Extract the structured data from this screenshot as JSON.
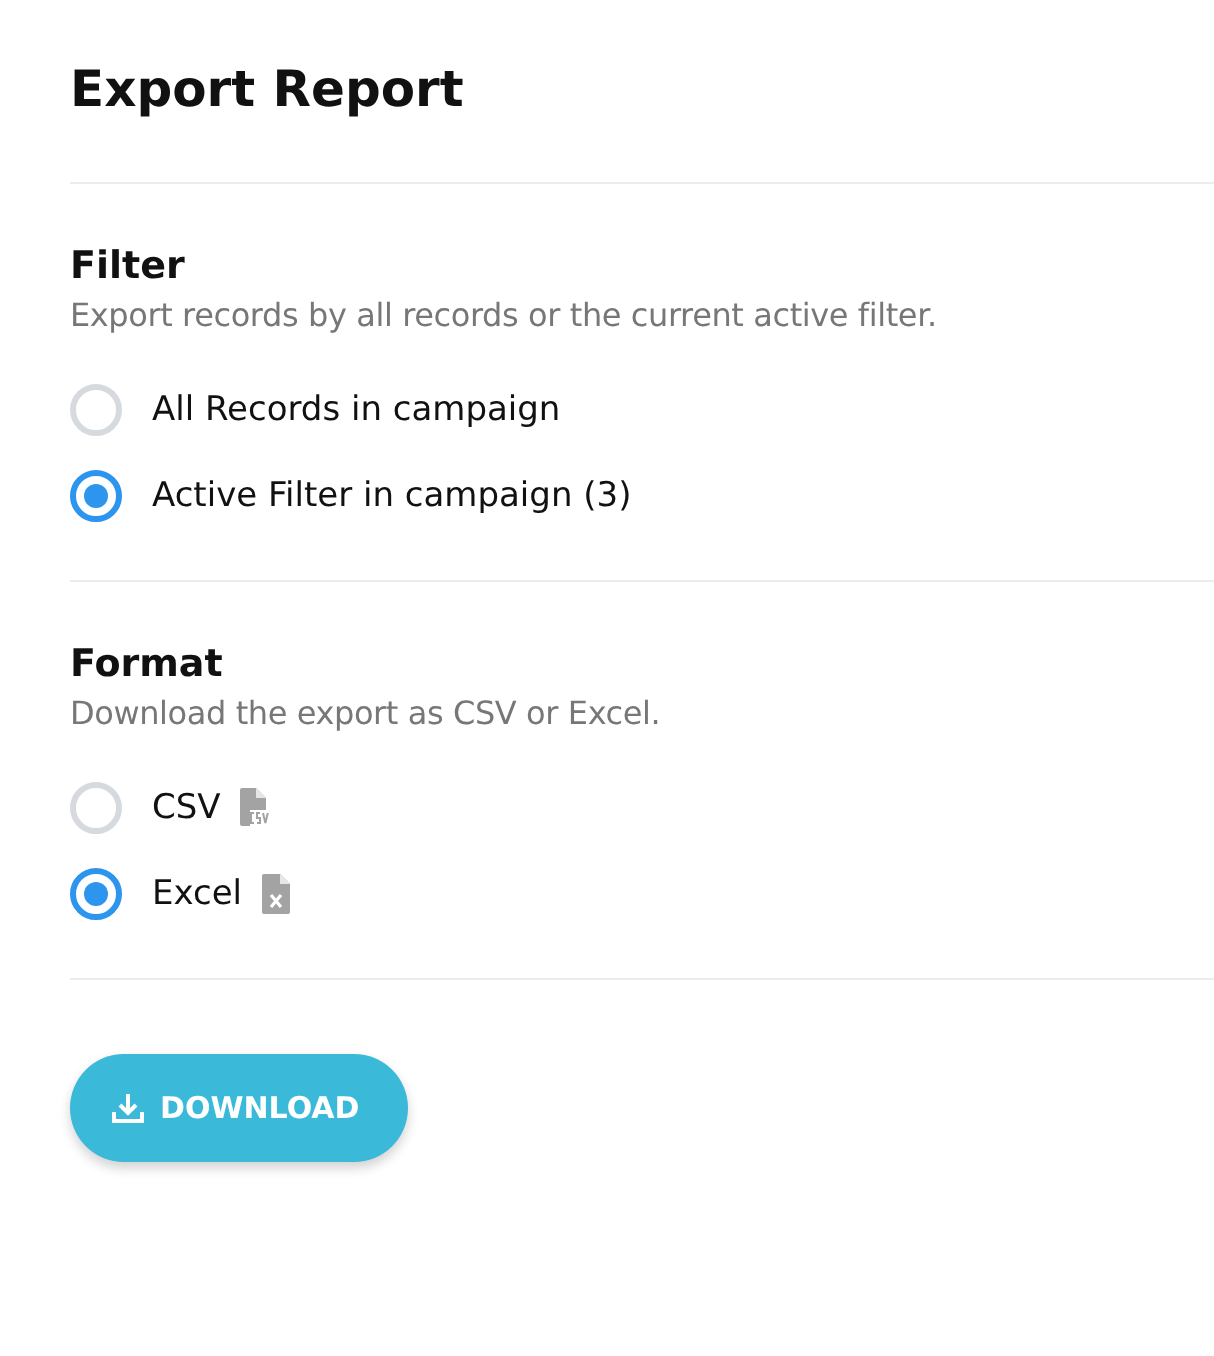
{
  "title": "Export Report",
  "sections": [
    {
      "heading": "Filter",
      "description": "Export records by all records or the current active filter.",
      "options": [
        {
          "label": "All Records in campaign",
          "selected": false
        },
        {
          "label": "Active Filter in campaign (3)",
          "selected": true
        }
      ]
    },
    {
      "heading": "Format",
      "description": "Download the export as CSV or Excel.",
      "options": [
        {
          "label": "CSV",
          "selected": false,
          "kind": "csv"
        },
        {
          "label": "Excel",
          "selected": true,
          "kind": "excel"
        }
      ]
    }
  ],
  "button": "DOWNLOAD"
}
